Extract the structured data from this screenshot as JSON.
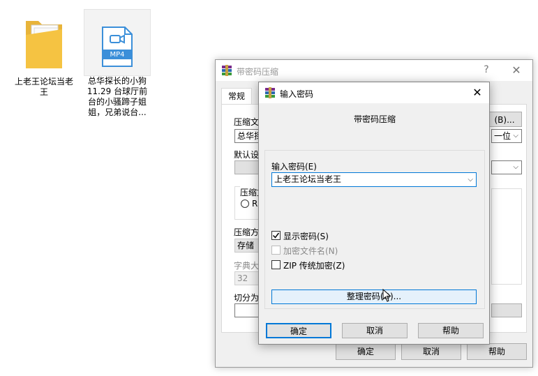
{
  "desktop": {
    "folder_icon": {
      "label": "上老王论坛当老\n王"
    },
    "mp4_icon": {
      "badge": "MP4",
      "label": "总华探长的小狗\n11.29 台球厅前\n台的小骚蹄子姐\n姐，兄弟说台..."
    }
  },
  "back_dialog": {
    "title": "带密码压缩",
    "help_glyph": "?",
    "close_glyph": "✕",
    "tab_general": "常规",
    "archive_label": "压缩文",
    "archive_value": "总华探",
    "browse_button": "(B)...",
    "unit_select": "一位",
    "default_profile_label": "默认设",
    "method_group_label": "压缩文",
    "method_radio": "R",
    "compress_method_label": "压缩方",
    "compress_method_value": "存储",
    "dict_label": "字典大",
    "dict_value": "32",
    "split_label": "切分为",
    "ok_button": "确定",
    "cancel_button": "取消",
    "help_button": "帮助"
  },
  "pwd_dialog": {
    "title": "输入密码",
    "close_glyph": "✕",
    "header": "带密码压缩",
    "password_label": "输入密码(E)",
    "password_value": "上老王论坛当老王",
    "show_password_label": "显示密码(S)",
    "show_password_checked": true,
    "encrypt_names_label": "加密文件名(N)",
    "encrypt_names_checked": false,
    "zip_legacy_label": "ZIP 传统加密(Z)",
    "zip_legacy_checked": false,
    "organize_button": "整理密码(O)...",
    "ok_button": "确定",
    "cancel_button": "取消",
    "help_button": "帮助"
  },
  "colors": {
    "accent": "#0078d7",
    "folder": "#f5c342",
    "mp4": "#3b8fd9"
  }
}
